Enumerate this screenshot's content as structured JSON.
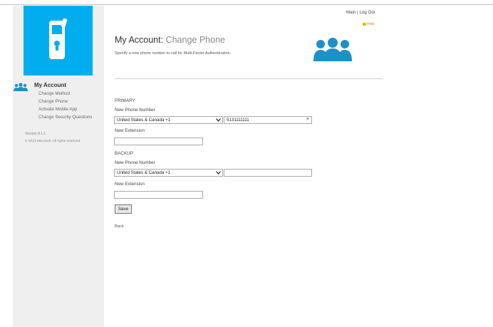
{
  "header": {
    "main_label": "Main",
    "separator": "|",
    "logout_label": "Log Out",
    "help_label": "Help"
  },
  "sidebar": {
    "title": "My Account",
    "items": [
      {
        "label": "Change Method"
      },
      {
        "label": "Change Phone"
      },
      {
        "label": "Activate Mobile App"
      },
      {
        "label": "Change Security Questions"
      }
    ],
    "version": "Version 8.1.1",
    "copyright": "© 2013 Microsoft. All rights reserved."
  },
  "page": {
    "title_prefix": "My Account: ",
    "title_accent": "Change Phone",
    "description": "Specify a new phone number to call for Multi-Factor Authentication."
  },
  "primary": {
    "section_label": "PRIMARY",
    "phone_label": "New Phone Number",
    "country_selected": "United States & Canada +1",
    "phone_value": "5131111111",
    "extension_label": "New Extension",
    "extension_value": ""
  },
  "backup": {
    "section_label": "BACKUP",
    "phone_label": "New Phone Number",
    "country_selected": "United States & Canada +1",
    "phone_value": "",
    "extension_label": "New Extension",
    "extension_value": ""
  },
  "actions": {
    "save_label": "Save",
    "back_label": "Back"
  },
  "colors": {
    "brand_blue": "#00aeef",
    "sidebar_bg": "#efefef",
    "help_yellow": "#e8b400"
  },
  "icons": {
    "logo": "mobile-phone-lock-icon",
    "account": "users-group-icon",
    "help": "help-icon",
    "select_arrow": "chevron-down-icon",
    "clear": "close-icon"
  }
}
